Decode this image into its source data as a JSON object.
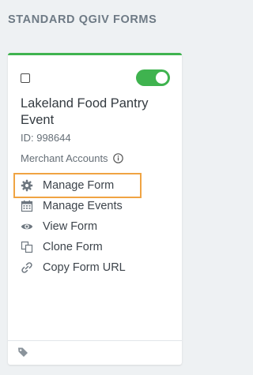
{
  "section": {
    "title": "STANDARD QGIV FORMS"
  },
  "card": {
    "form_name": "Lakeland Food Pantry Event",
    "form_id": "ID: 998644",
    "merchant_label": "Merchant Accounts",
    "toggle_state": "on",
    "accent_color": "#3fb34f",
    "highlight_color": "#f0a443",
    "actions": [
      {
        "label": "Manage Form",
        "icon": "gear-icon"
      },
      {
        "label": "Manage Events",
        "icon": "calendar-icon"
      },
      {
        "label": "View Form",
        "icon": "eye-icon"
      },
      {
        "label": "Clone Form",
        "icon": "clone-icon"
      },
      {
        "label": "Copy Form URL",
        "icon": "link-icon"
      }
    ],
    "footer_icon": "tag-icon"
  }
}
